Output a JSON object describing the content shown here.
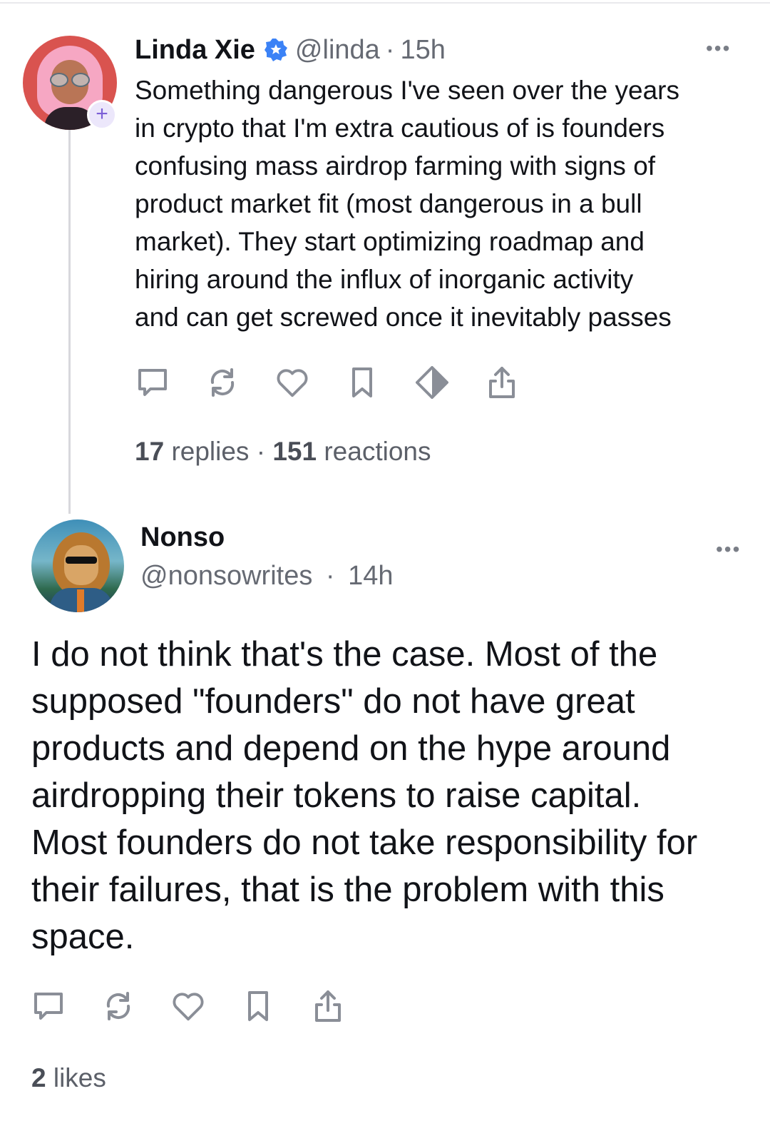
{
  "post1": {
    "author_name": "Linda Xie",
    "handle": "@linda",
    "separator": "·",
    "time": "15h",
    "lines": [
      "Something dangerous I've seen over the years",
      "in crypto that I'm extra cautious of is founders",
      "confusing mass airdrop farming with signs of",
      "product market fit (most dangerous in a bull",
      "market). They start optimizing roadmap and",
      "hiring around the influx of inorganic activity",
      "and can get screwed once it inevitably passes"
    ],
    "more_label": "•••",
    "follow_badge": "+",
    "replies_count": "17",
    "replies_label": "replies",
    "stats_separator": "·",
    "reactions_count": "151",
    "reactions_label": "reactions",
    "icons": [
      "reply-icon",
      "recast-icon",
      "like-icon",
      "bookmark-icon",
      "tip-icon",
      "share-icon"
    ]
  },
  "post2": {
    "author_name": "Nonso",
    "handle": "@nonsowrites",
    "separator": "·",
    "time": "14h",
    "more_label": "•••",
    "lines": [
      "I do not think that's the case. Most of the",
      "supposed \"founders\" do not have great",
      "products and depend on the hype around",
      "airdropping their tokens to raise capital.",
      "Most founders do not take responsibility for",
      "their failures, that is the problem with this",
      "space."
    ],
    "likes_count": "2",
    "likes_label": "likes",
    "icons": [
      "reply-icon",
      "recast-icon",
      "like-icon",
      "bookmark-icon",
      "share-icon"
    ]
  },
  "colors": {
    "text": "#111318",
    "muted": "#666a73",
    "icon": "#8a8e97",
    "verified": "#3b82f6",
    "thread_line": "#d8d8dc"
  }
}
